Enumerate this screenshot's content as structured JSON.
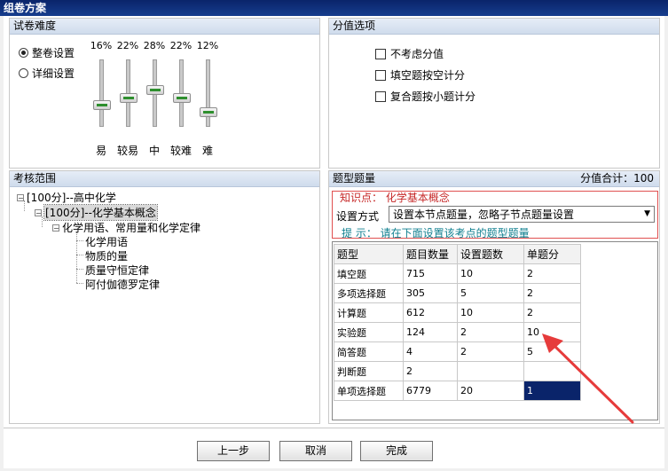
{
  "window": {
    "title": "组卷方案"
  },
  "difficulty": {
    "header": "试卷难度",
    "mode_options": [
      {
        "label": "整卷设置",
        "selected": true
      },
      {
        "label": "详细设置",
        "selected": false
      }
    ],
    "levels": [
      {
        "label": "易",
        "percent": "16%"
      },
      {
        "label": "较易",
        "percent": "22%"
      },
      {
        "label": "中",
        "percent": "28%"
      },
      {
        "label": "较难",
        "percent": "22%"
      },
      {
        "label": "难",
        "percent": "12%"
      }
    ]
  },
  "score_options": {
    "header": "分值选项",
    "items": [
      {
        "label": "不考虑分值",
        "checked": false
      },
      {
        "label": "填空题按空计分",
        "checked": false
      },
      {
        "label": "复合题按小题计分",
        "checked": false
      }
    ]
  },
  "scope": {
    "header": "考核范围",
    "tree": [
      {
        "text": "[100分]--高中化学",
        "expander": "−"
      },
      {
        "text": "[100分]--化学基本概念",
        "expander": "−",
        "selected": true
      },
      {
        "text": "化学用语、常用量和化学定律",
        "expander": "−"
      },
      {
        "text": "化学用语"
      },
      {
        "text": "物质的量"
      },
      {
        "text": "质量守恒定律"
      },
      {
        "text": "阿付伽德罗定律"
      }
    ]
  },
  "question_types": {
    "header": "题型题量",
    "total_label": "分值合计：100",
    "knowledge_label": "知识点：",
    "knowledge_value": "化学基本概念",
    "setting_label": "设置方式",
    "setting_value": "设置本节点题量，忽略子节点题量设置",
    "hint_label": "提 示：",
    "hint_text": "请在下面设置该考点的题型题量",
    "columns": [
      "题型",
      "题目数量",
      "设置题数",
      "单题分"
    ],
    "rows": [
      [
        "填空题",
        "715",
        "10",
        "2"
      ],
      [
        "多项选择题",
        "305",
        "5",
        "2"
      ],
      [
        "计算题",
        "612",
        "10",
        "2"
      ],
      [
        "实验题",
        "124",
        "2",
        "10"
      ],
      [
        "简答题",
        "4",
        "2",
        "5"
      ],
      [
        "判断题",
        "2",
        "",
        ""
      ],
      [
        "单项选择题",
        "6779",
        "20",
        "1"
      ]
    ]
  },
  "buttons": {
    "prev": "上一步",
    "cancel": "取消",
    "finish": "完成"
  },
  "colors": {
    "title_bar": "#0a246a",
    "annotation_arrow": "#e63b3b",
    "selected_cell": "#0a246a"
  }
}
